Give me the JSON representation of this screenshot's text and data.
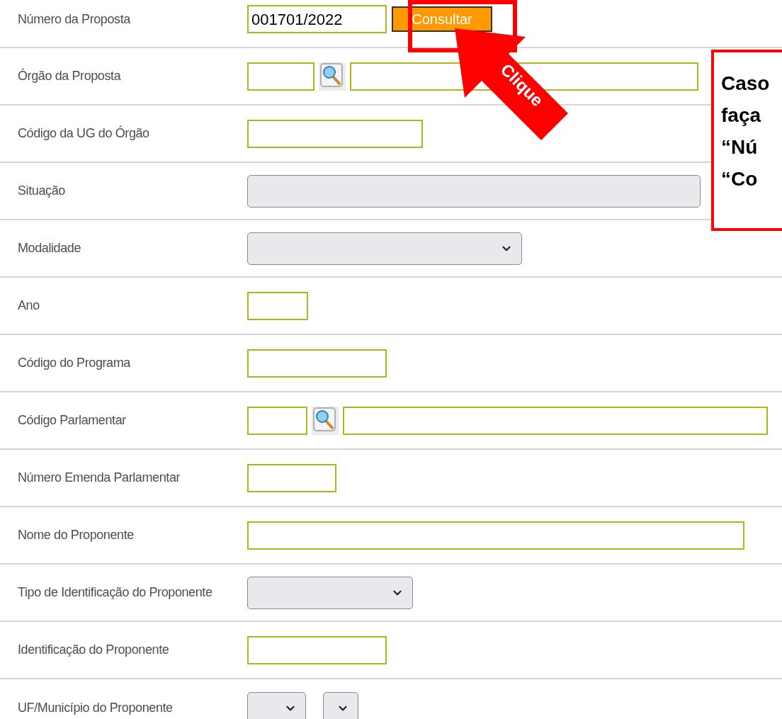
{
  "form": {
    "rows": [
      {
        "label": "Número da Proposta",
        "kind": "query",
        "value": "001701/2022",
        "button": "Consultar"
      },
      {
        "label": "Órgão da Proposta",
        "kind": "lookup"
      },
      {
        "label": "Código da UG do Órgão",
        "kind": "text"
      },
      {
        "label": "Situação",
        "kind": "readonly"
      },
      {
        "label": "Modalidade",
        "kind": "select"
      },
      {
        "label": "Ano",
        "kind": "text"
      },
      {
        "label": "Código do Programa",
        "kind": "text"
      },
      {
        "label": "Código Parlamentar",
        "kind": "lookup"
      },
      {
        "label": "Número Emenda Parlamentar",
        "kind": "text"
      },
      {
        "label": "Nome do Proponente",
        "kind": "text"
      },
      {
        "label": "Tipo de Identificação do Proponente",
        "kind": "select"
      },
      {
        "label": "Identificação do Proponente",
        "kind": "text"
      },
      {
        "label": "UF/Município do Proponente",
        "kind": "double-select"
      }
    ]
  },
  "annotation": {
    "arrow_label": "Clique",
    "callout_lines": [
      "Caso",
      "faça",
      "“Nú",
      "“Co"
    ]
  }
}
